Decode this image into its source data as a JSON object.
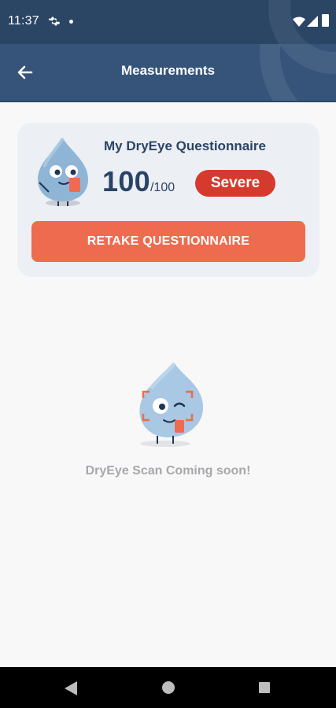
{
  "status_bar": {
    "time": "11:37",
    "icons": [
      "gear-icon",
      "notification-dot",
      "wifi-icon",
      "cell-signal-icon",
      "battery-icon"
    ]
  },
  "app_bar": {
    "title": "Measurements",
    "back_icon": "arrow-left-icon",
    "color": "#36547a"
  },
  "questionnaire_card": {
    "title": "My DryEye Questionnaire",
    "score": "100",
    "score_max": "/100",
    "severity": "Severe",
    "severity_color": "#d53a2d",
    "button_label": "RETAKE QUESTIONNAIRE",
    "button_color": "#ee6b4f"
  },
  "scan_section": {
    "message": "DryEye Scan Coming soon!"
  },
  "nav_bar": {
    "icons": [
      "back-triangle-icon",
      "home-circle-icon",
      "recents-square-icon"
    ]
  }
}
